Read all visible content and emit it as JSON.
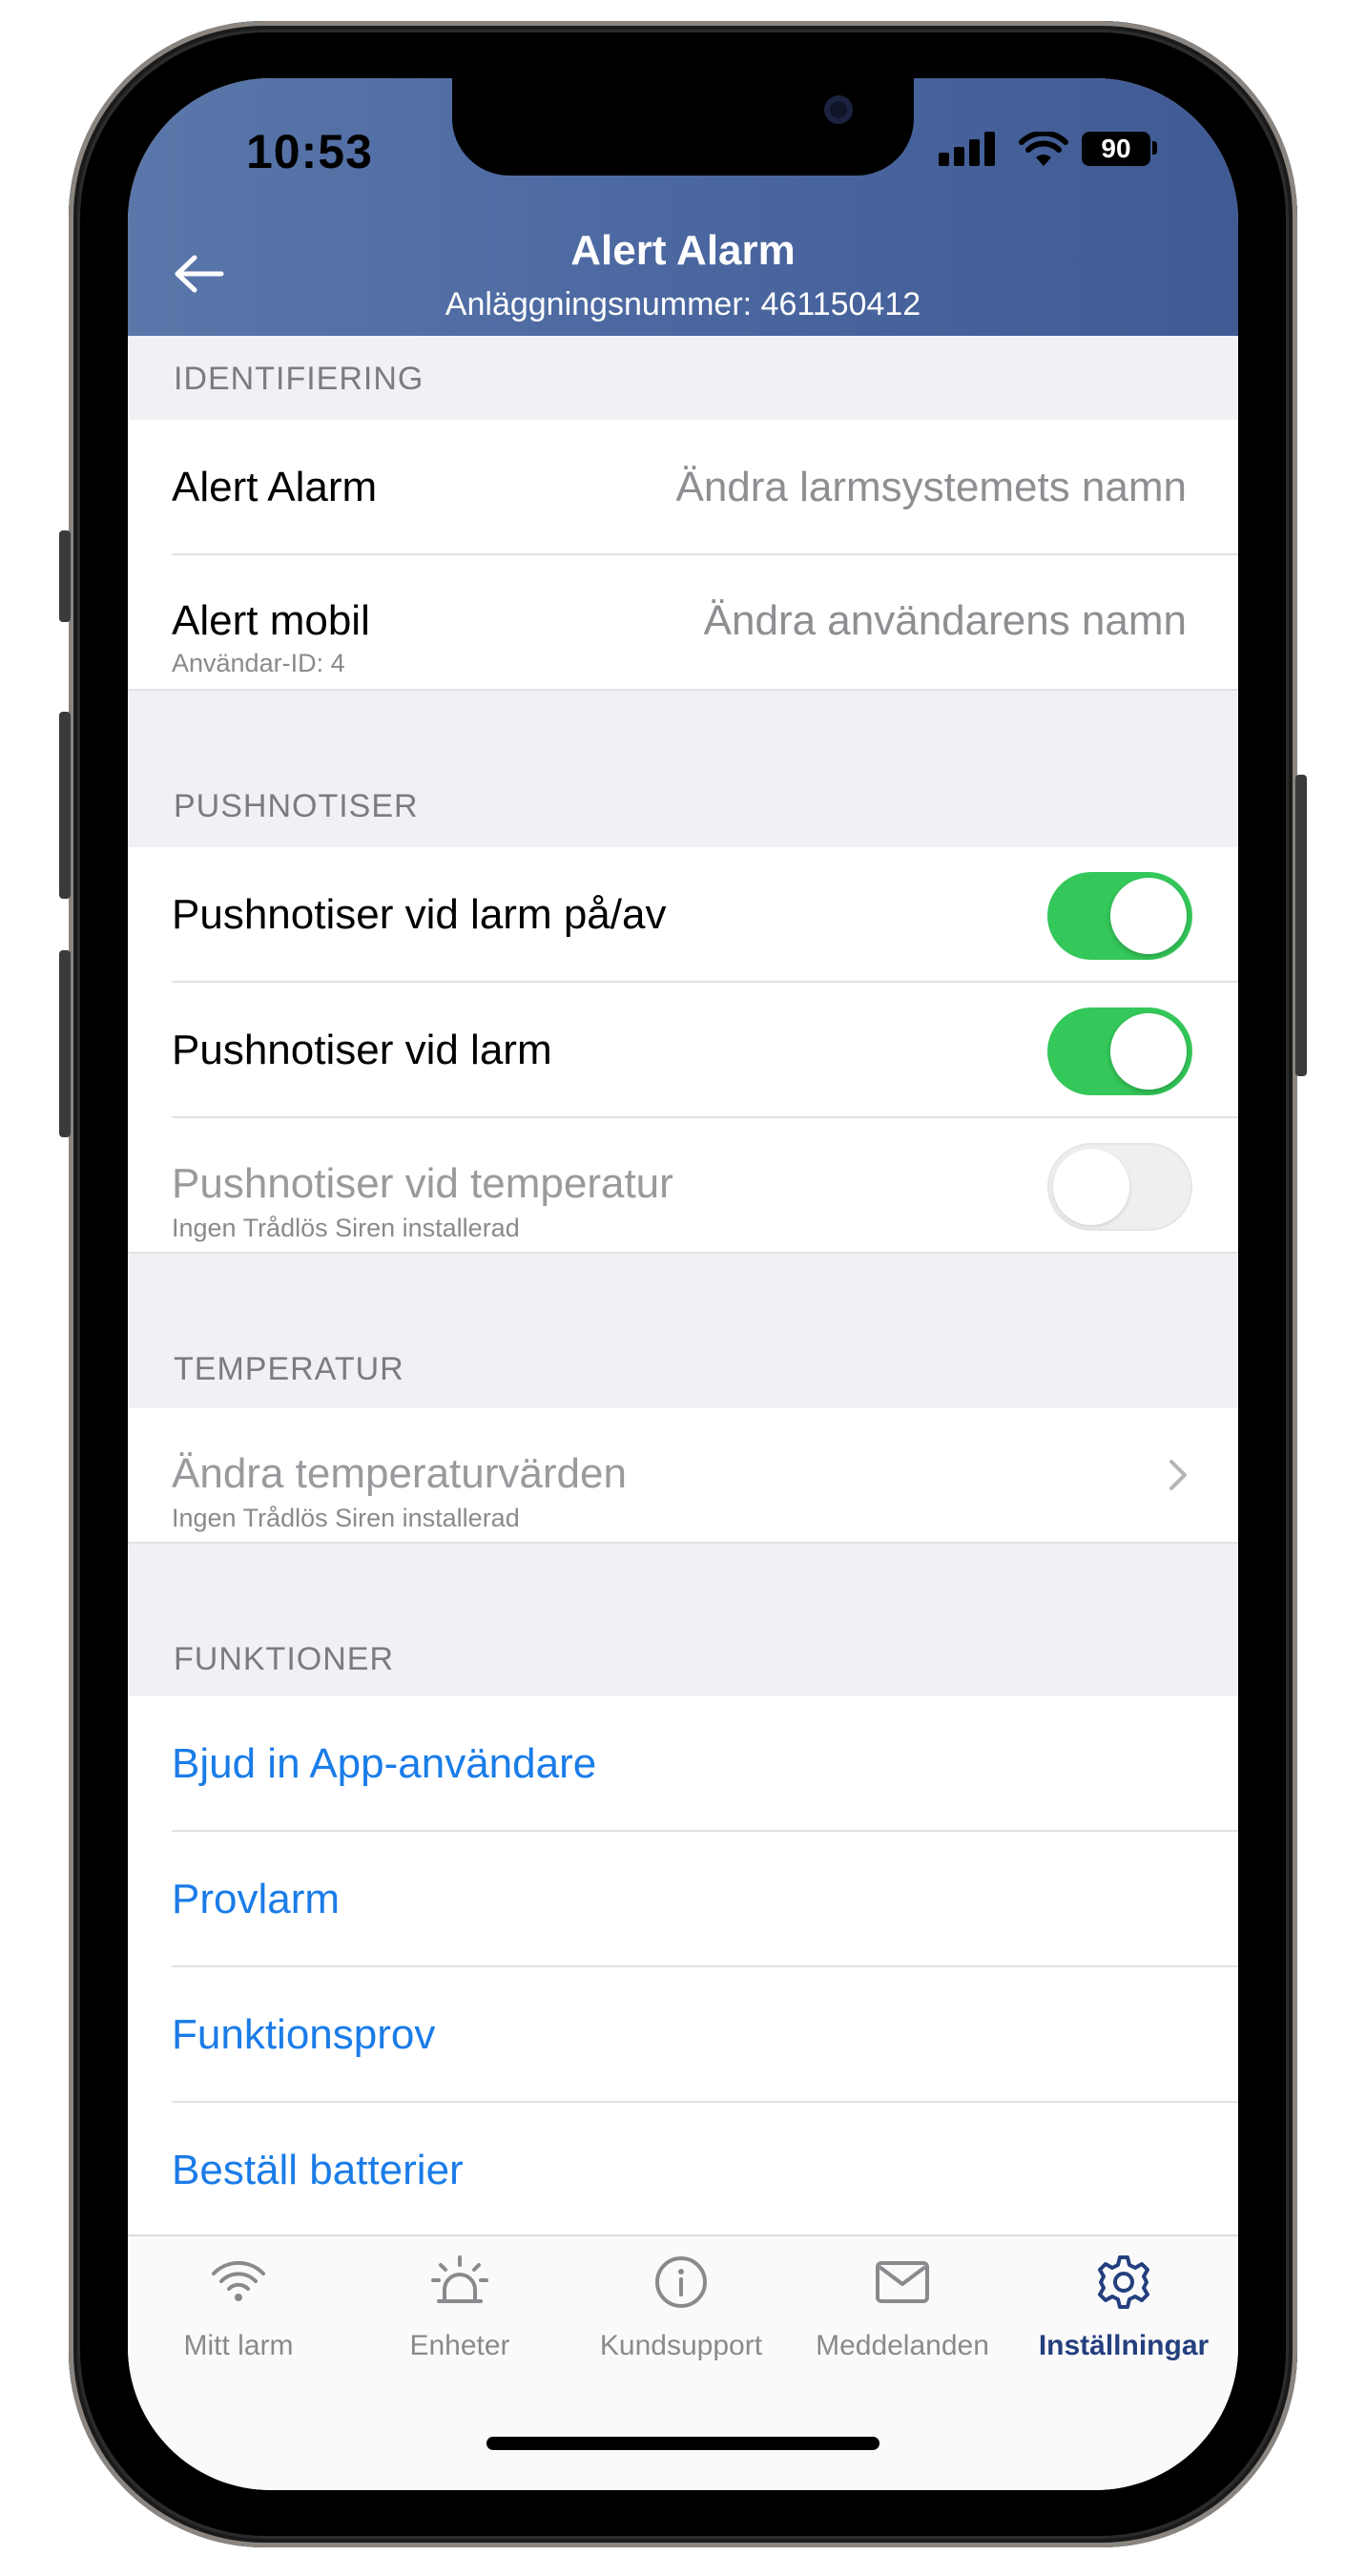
{
  "status_bar": {
    "time": "10:53",
    "battery": "90"
  },
  "header": {
    "title": "Alert Alarm",
    "subtitle": "Anläggningsnummer: 461150412"
  },
  "identifiering": {
    "heading": "IDENTIFIERING",
    "items": [
      {
        "label": "Alert Alarm",
        "action": "Ändra larmsystemets namn",
        "sub": ""
      },
      {
        "label": "Alert mobil",
        "action": "Ändra användarens namn",
        "sub": "Användar-ID: 4"
      }
    ]
  },
  "pushnotiser": {
    "heading": "PUSHNOTISER",
    "items": [
      {
        "label": "Pushnotiser vid larm på/av",
        "enabled": true,
        "on": true,
        "sub": ""
      },
      {
        "label": "Pushnotiser vid larm",
        "enabled": true,
        "on": true,
        "sub": ""
      },
      {
        "label": "Pushnotiser vid temperatur",
        "enabled": false,
        "on": false,
        "sub": "Ingen Trådlös Siren installerad"
      }
    ]
  },
  "temperatur": {
    "heading": "TEMPERATUR",
    "items": [
      {
        "label": "Ändra temperaturvärden",
        "sub": "Ingen Trådlös Siren installerad",
        "enabled": false
      }
    ]
  },
  "funktioner": {
    "heading": "FUNKTIONER",
    "items": [
      {
        "label": "Bjud in App-användare"
      },
      {
        "label": "Provlarm"
      },
      {
        "label": "Funktionsprov"
      },
      {
        "label": "Beställ batterier"
      }
    ]
  },
  "tabbar": {
    "items": [
      {
        "label": "Mitt larm",
        "icon": "wifi-icon",
        "active": false
      },
      {
        "label": "Enheter",
        "icon": "siren-icon",
        "active": false
      },
      {
        "label": "Kundsupport",
        "icon": "info-icon",
        "active": false
      },
      {
        "label": "Meddelanden",
        "icon": "envelope-icon",
        "active": false
      },
      {
        "label": "Inställningar",
        "icon": "gear-icon",
        "active": true
      }
    ]
  },
  "colors": {
    "header_blue": "#4b67a0",
    "toggle_on": "#34c759",
    "link_blue": "#1a7ce8",
    "tab_active": "#243f7e"
  }
}
